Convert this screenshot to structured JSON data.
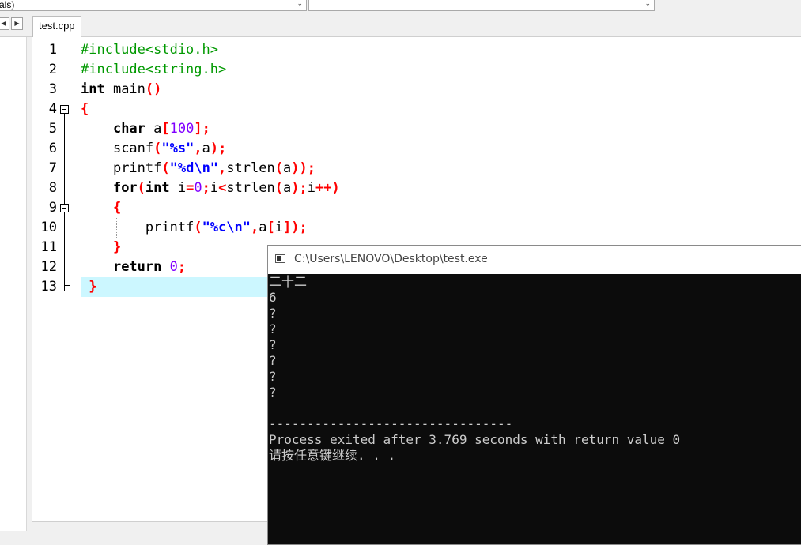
{
  "toolbar": {
    "combo1_value": "als)",
    "combo2_value": ""
  },
  "tabs": [
    {
      "label": "test.cpp"
    }
  ],
  "editor": {
    "line_numbers": [
      "1",
      "2",
      "3",
      "4",
      "5",
      "6",
      "7",
      "8",
      "9",
      "10",
      "11",
      "12",
      "13"
    ]
  },
  "console": {
    "title": "C:\\Users\\LENOVO\\Desktop\\test.exe",
    "lines": [
      "二十二",
      "6",
      "?",
      "?",
      "?",
      "?",
      "?",
      "?",
      "",
      "--------------------------------",
      "Process exited after 3.769 seconds with return value 0",
      "请按任意键继续. . ."
    ]
  },
  "colors": {
    "preprocessor": "#009900",
    "keyword": "#000000",
    "symbol": "#ff0000",
    "number": "#8000ff",
    "string": "#0000ff",
    "current_line": "#ccf7ff",
    "console_bg": "#0c0c0c",
    "console_text": "#cccccc"
  },
  "code": {
    "l1": "#include<stdio.h>",
    "l2": "#include<string.h>",
    "l3_kw": "int",
    "l3_rest": " main",
    "l3_sym": "()",
    "l4": "{",
    "l5_kw": "char",
    "l5_a": " a",
    "l5_o": "[",
    "l5_n": "100",
    "l5_c": "];",
    "l6_a": "scanf",
    "l6_b": "(",
    "l6_s": "\"%s\"",
    "l6_c": ",",
    "l6_d": "a",
    "l6_e": ");",
    "l7_a": "printf",
    "l7_b": "(",
    "l7_s": "\"%d\\n\"",
    "l7_c": ",",
    "l7_d": "strlen",
    "l7_e": "(",
    "l7_f": "a",
    "l7_g": "));",
    "l8_kw": "for",
    "l8_b": "(",
    "l8_kw2": "int",
    "l8_c": " i",
    "l8_d": "=",
    "l8_n": "0",
    "l8_e": ";",
    "l8_f": "i",
    "l8_g": "<",
    "l8_h": "strlen",
    "l8_i": "(",
    "l8_j": "a",
    "l8_k": ");",
    "l8_l": "i",
    "l8_m": "++)",
    "l9": "{",
    "l10_a": "printf",
    "l10_b": "(",
    "l10_s": "\"%c\\n\"",
    "l10_c": ",",
    "l10_d": "a",
    "l10_e": "[",
    "l10_f": "i",
    "l10_g": "]);",
    "l11": "}",
    "l12_kw": "return",
    "l12_n": "0",
    "l12_e": ";",
    "l13": "}"
  }
}
